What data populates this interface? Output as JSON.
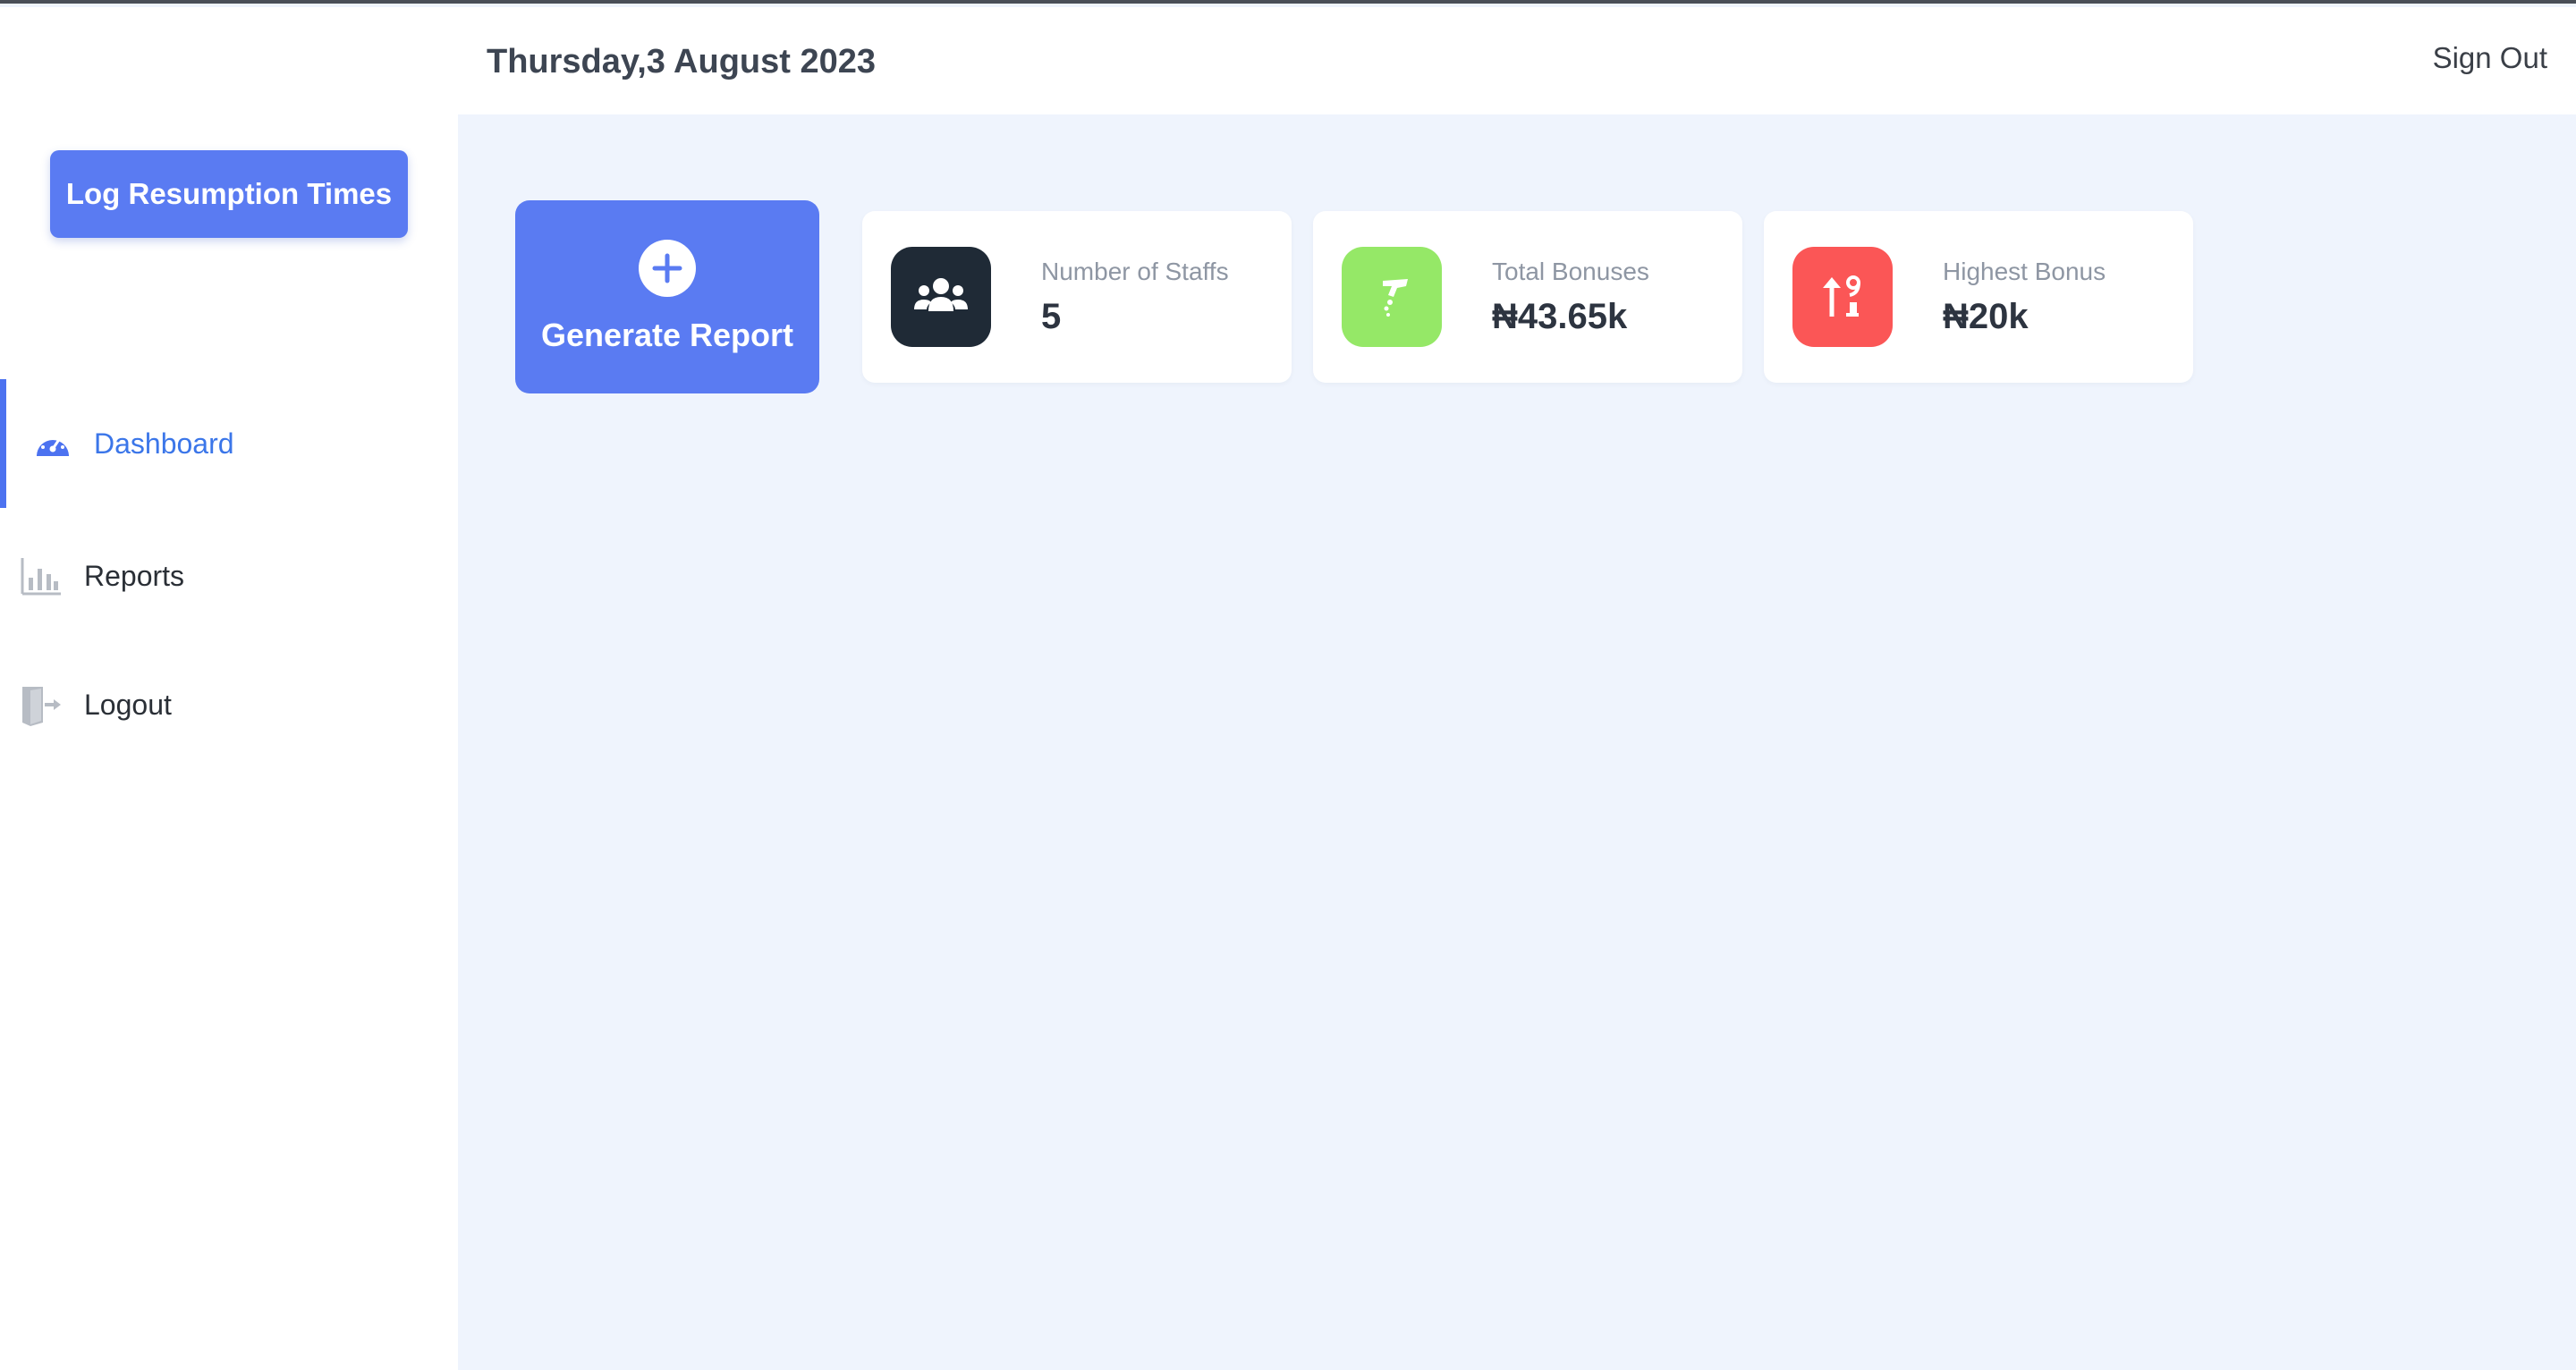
{
  "header": {
    "date": "Thursday,3 August 2023",
    "signout_label": "Sign Out"
  },
  "sidebar": {
    "log_button_label": "Log Resumption Times",
    "items": [
      {
        "label": "Dashboard",
        "icon": "speedometer-icon",
        "active": true
      },
      {
        "label": "Reports",
        "icon": "bar-chart-icon",
        "active": false
      },
      {
        "label": "Logout",
        "icon": "door-exit-icon",
        "active": false
      }
    ]
  },
  "main": {
    "generate_report": {
      "label": "Generate Report",
      "icon": "plus-circle-icon"
    },
    "stats": [
      {
        "label": "Number of Staffs",
        "value": "5",
        "icon": "users-icon",
        "color": "#1f2a36"
      },
      {
        "label": "Total Bonuses",
        "value": "₦43.65k",
        "icon": "hand-money-icon",
        "color": "#95e867"
      },
      {
        "label": "Highest Bonus",
        "value": "₦20k",
        "icon": "sort-numeric-up-icon",
        "color": "#fb5656"
      }
    ]
  },
  "colors": {
    "accent": "#5a7bf2",
    "background": "#eff4fd",
    "active_nav": "#3b76e9"
  }
}
